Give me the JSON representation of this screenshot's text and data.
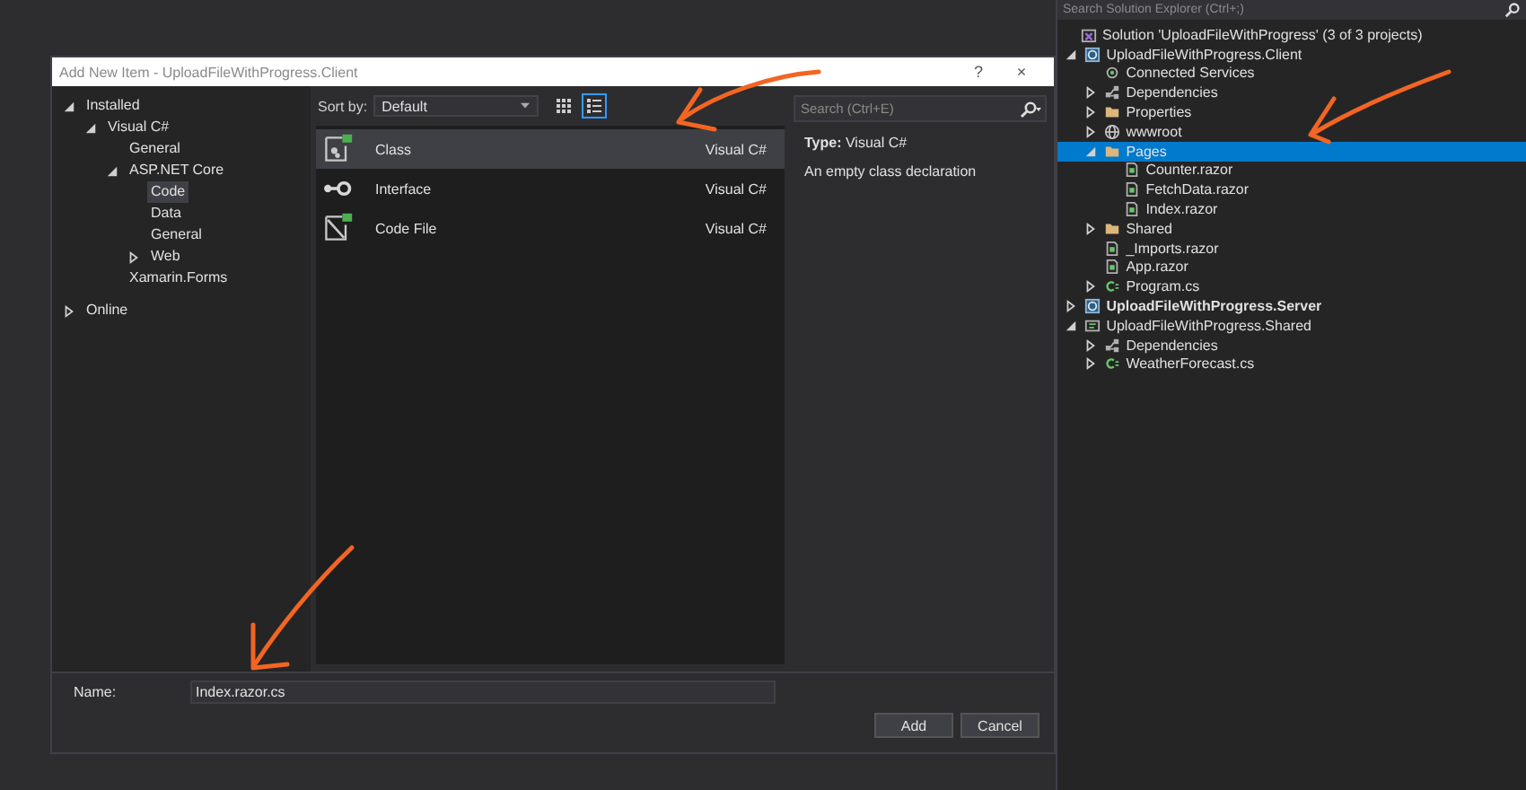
{
  "dialog": {
    "title": "Add New Item - UploadFileWithProgress.Client",
    "help": "?",
    "close": "×",
    "tree": [
      {
        "label": "Installed",
        "expanded": true,
        "selected": false,
        "children": [
          {
            "label": "Visual C#",
            "expanded": true,
            "selected": false,
            "children": [
              {
                "label": "General",
                "selected": false
              },
              {
                "label": "ASP.NET Core",
                "expanded": true,
                "selected": false,
                "children": [
                  {
                    "label": "Code",
                    "selected": true
                  },
                  {
                    "label": "Data",
                    "selected": false
                  },
                  {
                    "label": "General",
                    "selected": false
                  },
                  {
                    "label": "Web",
                    "expanded": false,
                    "selected": false
                  }
                ]
              },
              {
                "label": "Xamarin.Forms",
                "selected": false
              }
            ]
          }
        ]
      },
      {
        "label": "Online",
        "expanded": false,
        "selected": false
      }
    ],
    "sort_label": "Sort by:",
    "sort_value": "Default",
    "view_modes": [
      {
        "kind": "grid",
        "selected": false
      },
      {
        "kind": "list",
        "selected": true
      }
    ],
    "templates": [
      {
        "kind": "class",
        "name": "Class",
        "language": "Visual C#",
        "selected": true
      },
      {
        "kind": "interface",
        "name": "Interface",
        "language": "Visual C#",
        "selected": false
      },
      {
        "kind": "codefile",
        "name": "Code File",
        "language": "Visual C#",
        "selected": false
      }
    ],
    "search_placeholder": "Search (Ctrl+E)",
    "details": {
      "type_label": "Type:",
      "type_value": "Visual C#",
      "description": "An empty class declaration"
    },
    "name_label": "Name:",
    "name_value": "Index.razor.cs",
    "buttons": [
      "Add",
      "Cancel"
    ]
  },
  "solution_explorer": {
    "search_placeholder": "Search Solution Explorer (Ctrl+;)",
    "tree": [
      {
        "kind": "solution",
        "label": "Solution 'UploadFileWithProgress' (3 of 3 projects)",
        "selected": false,
        "children": [
          {
            "kind": "project",
            "label": "UploadFileWithProgress.Client",
            "startup": false,
            "expanded": true,
            "selected": false,
            "children": [
              {
                "kind": "connected",
                "label": "Connected Services",
                "selected": false
              },
              {
                "kind": "dependencies",
                "label": "Dependencies",
                "expanded": false,
                "selected": false
              },
              {
                "kind": "folder",
                "label": "Properties",
                "expanded": false,
                "selected": false
              },
              {
                "kind": "globe",
                "label": "wwwroot",
                "expanded": false,
                "selected": false
              },
              {
                "kind": "folder",
                "label": "Pages",
                "expanded": true,
                "selected": true,
                "children": [
                  {
                    "kind": "razor",
                    "label": "Counter.razor",
                    "selected": false
                  },
                  {
                    "kind": "razor",
                    "label": "FetchData.razor",
                    "selected": false
                  },
                  {
                    "kind": "razor",
                    "label": "Index.razor",
                    "selected": false
                  }
                ]
              },
              {
                "kind": "folder",
                "label": "Shared",
                "expanded": false,
                "selected": false
              },
              {
                "kind": "razor",
                "label": "_Imports.razor",
                "selected": false
              },
              {
                "kind": "razor",
                "label": "App.razor",
                "selected": false
              },
              {
                "kind": "cs",
                "label": "Program.cs",
                "expanded": false,
                "selected": false
              }
            ]
          },
          {
            "kind": "project",
            "label": "UploadFileWithProgress.Server",
            "startup": true,
            "expanded": false,
            "selected": false
          },
          {
            "kind": "library",
            "label": "UploadFileWithProgress.Shared",
            "startup": false,
            "expanded": true,
            "selected": false,
            "children": [
              {
                "kind": "dependencies",
                "label": "Dependencies",
                "expanded": false,
                "selected": false
              },
              {
                "kind": "cs",
                "label": "WeatherForecast.cs",
                "expanded": false,
                "selected": false
              }
            ]
          }
        ]
      }
    ]
  }
}
